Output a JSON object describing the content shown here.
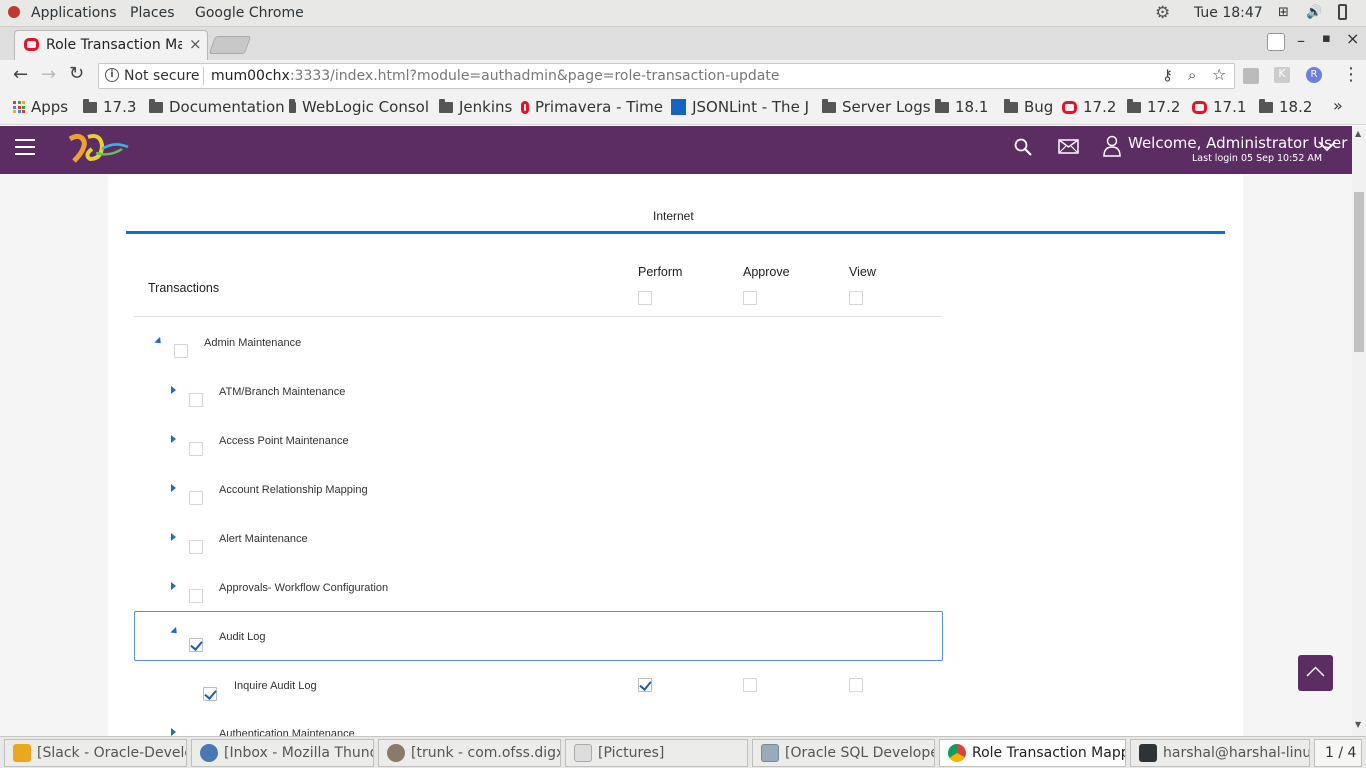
{
  "os": {
    "applications": "Applications",
    "places": "Places",
    "active_app": "Google Chrome",
    "clock": "Tue 18:47"
  },
  "browser": {
    "tab_title": "Role Transaction Ma",
    "url_security": "Not secure",
    "url_host": "mum00chx",
    "url_rest": ":3333/index.html?module=authadmin&page=role-transaction-update",
    "bookmarks": [
      {
        "label": "Apps",
        "icon": "apps-grid-icon"
      },
      {
        "label": "17.3",
        "icon": "folder-icon"
      },
      {
        "label": "Documentation",
        "icon": "folder-icon"
      },
      {
        "label": "WebLogic Consol",
        "icon": "folder-icon"
      },
      {
        "label": "Jenkins",
        "icon": "folder-icon"
      },
      {
        "label": "Primavera - Time",
        "icon": "oracle-icon"
      },
      {
        "label": "JSONLint - The J",
        "icon": "json-icon"
      },
      {
        "label": "Server Logs",
        "icon": "folder-icon"
      },
      {
        "label": "18.1",
        "icon": "folder-icon"
      },
      {
        "label": "Bug",
        "icon": "folder-icon"
      },
      {
        "label": "17.2",
        "icon": "oracle-icon"
      },
      {
        "label": "17.2",
        "icon": "folder-icon"
      },
      {
        "label": "17.1",
        "icon": "oracle-icon"
      },
      {
        "label": "18.2",
        "icon": "folder-icon"
      }
    ],
    "more": "»"
  },
  "header": {
    "welcome": "Welcome, Administrator User",
    "last_login": "Last login 05 Sep 10:52 AM",
    "brand_color": "#5c2d63"
  },
  "content": {
    "tab": "Internet",
    "transactions_header": "Transactions",
    "columns": [
      "Perform",
      "Approve",
      "View"
    ],
    "rows": [
      {
        "label": "Admin Maintenance",
        "level": 0,
        "expanded": true,
        "checked": false
      },
      {
        "label": "ATM/Branch Maintenance",
        "level": 1,
        "expanded": false,
        "checked": false
      },
      {
        "label": "Access Point Maintenance",
        "level": 1,
        "expanded": false,
        "checked": false
      },
      {
        "label": "Account Relationship Mapping",
        "level": 1,
        "expanded": false,
        "checked": false
      },
      {
        "label": "Alert Maintenance",
        "level": 1,
        "expanded": false,
        "checked": false
      },
      {
        "label": "Approvals- Workflow Configuration",
        "level": 1,
        "expanded": false,
        "checked": false
      },
      {
        "label": "Audit Log",
        "level": 1,
        "expanded": true,
        "checked": true
      },
      {
        "label": "Inquire Audit Log",
        "level": 2,
        "checked": true,
        "perform": true,
        "approve": false,
        "view": false
      },
      {
        "label": "Authentication Maintenance",
        "level": 1,
        "expanded": false,
        "checked": false
      }
    ]
  },
  "taskbar": {
    "tasks": [
      "[Slack - Oracle-Develo…",
      "[Inbox - Mozilla Thund…",
      "[trunk - com.ofss.digx.…",
      "[Pictures]",
      "[Oracle SQL Developer…",
      "Role Transaction Mapp…",
      "harshal@harshal-linux:~"
    ],
    "workspace": "1 / 4"
  }
}
